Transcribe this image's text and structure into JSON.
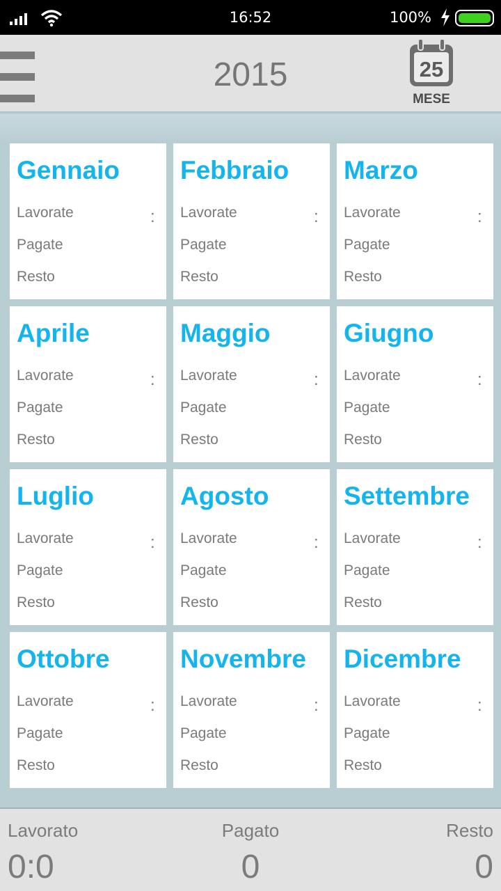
{
  "status_bar": {
    "time": "16:52",
    "battery_percent": "100%",
    "battery_level": 1.0,
    "icons": [
      "signal-icon",
      "wifi-icon",
      "charging-bolt-icon",
      "battery-icon"
    ]
  },
  "header": {
    "title": "2015",
    "month_button_number": "25",
    "month_button_label": "MESE",
    "icons": [
      "menu-icon",
      "calendar-icon"
    ]
  },
  "row_labels": {
    "worked": "Lavorate",
    "paid": "Pagate",
    "rest": "Resto",
    "separator": ":"
  },
  "months": [
    {
      "name": "Gennaio"
    },
    {
      "name": "Febbraio"
    },
    {
      "name": "Marzo"
    },
    {
      "name": "Aprile"
    },
    {
      "name": "Maggio"
    },
    {
      "name": "Giugno"
    },
    {
      "name": "Luglio"
    },
    {
      "name": "Agosto"
    },
    {
      "name": "Settembre"
    },
    {
      "name": "Ottobre"
    },
    {
      "name": "Novembre"
    },
    {
      "name": "Dicembre"
    }
  ],
  "footer": {
    "worked_label": "Lavorato",
    "worked_value": "0:0",
    "paid_label": "Pagato",
    "paid_value": "0",
    "rest_label": "Resto",
    "rest_value": "0"
  },
  "colors": {
    "accent": "#14b4ef",
    "background": "#b9ced3",
    "bar": "#e2e2e2",
    "battery": "#3ed21e"
  }
}
